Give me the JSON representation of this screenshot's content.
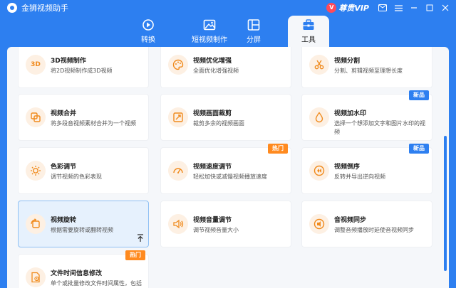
{
  "app": {
    "title": "金狮视频助手"
  },
  "window": {
    "vip_label": "尊贵VIP",
    "vip_icon": "V"
  },
  "tabs": [
    {
      "id": "convert",
      "label": "转换"
    },
    {
      "id": "short",
      "label": "短视频制作"
    },
    {
      "id": "split",
      "label": "分屏"
    },
    {
      "id": "tools",
      "label": "工具",
      "active": true
    }
  ],
  "cards": [
    {
      "title": "3D视频制作",
      "desc": "将2D视频制作成3D视频",
      "icon": "3d-icon"
    },
    {
      "title": "视频优化增强",
      "desc": "全面优化增强视频",
      "icon": "palette-icon"
    },
    {
      "title": "视频分割",
      "desc": "分割、剪辑视频至理想长度",
      "icon": "scissors-icon"
    },
    {
      "title": "视频合并",
      "desc": "将多段音视频素材合并为一个视频",
      "icon": "merge-icon"
    },
    {
      "title": "视频画面裁剪",
      "desc": "裁剪多余的视频画面",
      "icon": "crop-icon"
    },
    {
      "title": "视频加水印",
      "desc": "选择一个想添加文字和图片水印的视频",
      "icon": "drop-icon",
      "badge": "新品"
    },
    {
      "title": "色彩调节",
      "desc": "调节视频的色彩表现",
      "icon": "sun-icon"
    },
    {
      "title": "视频速度调节",
      "desc": "轻松加快或减慢视频播放速度",
      "icon": "speedometer-icon",
      "badge": "热门"
    },
    {
      "title": "视频倒序",
      "desc": "反转并导出逆向视频",
      "icon": "rewind-icon",
      "badge": "新品"
    },
    {
      "title": "视频旋转",
      "desc": "根据需要旋转或翻转视频",
      "icon": "rotate-icon"
    },
    {
      "title": "视频音量调节",
      "desc": "调节视频音量大小",
      "icon": "volume-icon"
    },
    {
      "title": "音视频同步",
      "desc": "调整音频播放时延使音视频同步",
      "icon": "sync-icon"
    },
    {
      "title": "文件时间信息修改",
      "desc": "单个或批量修改文件时间属性，包括",
      "icon": "file-time-icon",
      "badge": "热门"
    }
  ],
  "colors": {
    "primary": "#2d7ff0",
    "accent_orange": "#ff8a1f",
    "selected_bg": "#e6f1fd"
  }
}
